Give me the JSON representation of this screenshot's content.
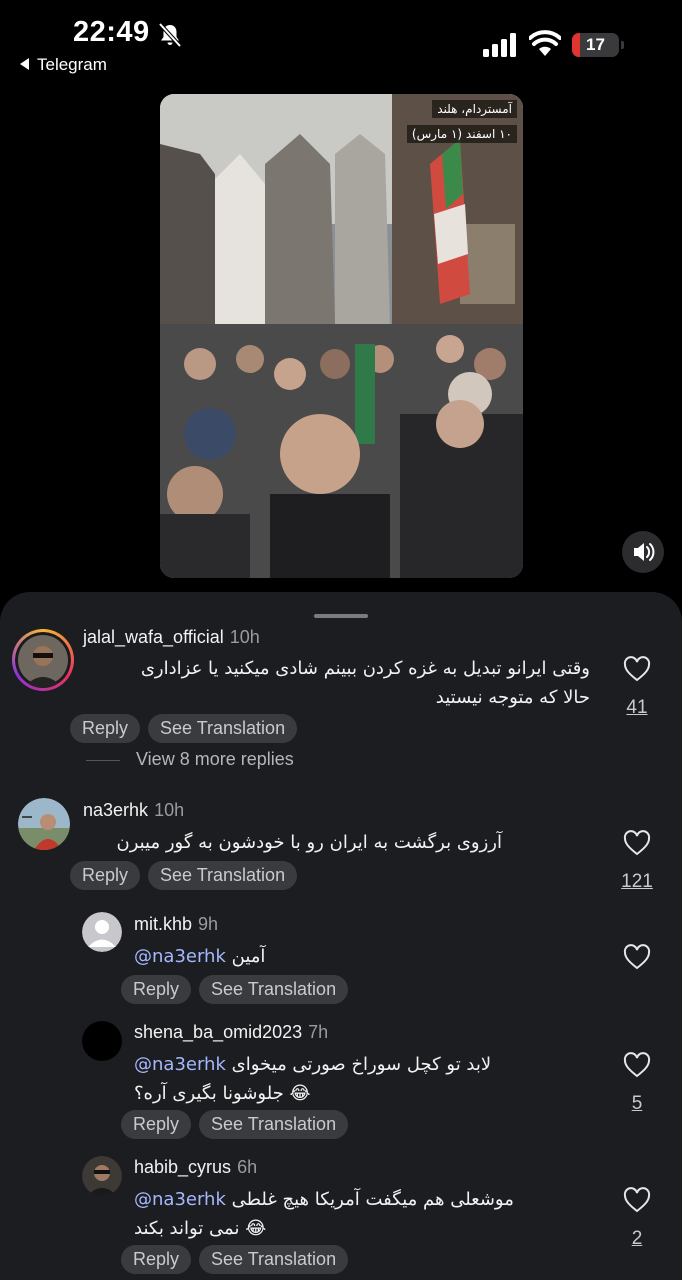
{
  "status_bar": {
    "time": "22:49",
    "back_app": "Telegram",
    "battery_level": "17",
    "battery_fraction": 0.17,
    "icons": [
      "bell-slash-icon",
      "cellular-signal-icon",
      "wifi-icon",
      "battery-icon"
    ]
  },
  "video": {
    "caption_location": "آمستردام، هلند",
    "caption_date": "۱۰ اسفند (۱ مارس)",
    "volume_icon": "speaker-icon"
  },
  "actions": {
    "reply": "Reply",
    "see_translation": "See Translation"
  },
  "comments": [
    {
      "username": "jalal_wafa_official",
      "time": "10h",
      "text_line1": "وقتی ایرانو تبدیل به غزه کردن ببینم شادی میکنید یا عزاداری",
      "text_line2": "حالا که متوجه نیستید",
      "likes": "41",
      "view_replies": "View 8 more replies"
    },
    {
      "username": "na3erhk",
      "time": "10h",
      "text_line1": "آرزوی برگشت به ایران رو با خودشون به گور میبرن",
      "likes": "121",
      "replies": [
        {
          "username": "mit.khb",
          "time": "9h",
          "mention": "@na3erhk",
          "text_line1": "آمین",
          "likes": ""
        },
        {
          "username": "shena_ba_omid2023",
          "time": "7h",
          "mention": "@na3erhk",
          "text_line1": "لابد تو کچل سوراخ صورتی میخوای",
          "text_line2": "جلوشونا بگیری آره؟ 😂",
          "likes": "5"
        },
        {
          "username": "habib_cyrus",
          "time": "6h",
          "mention": "@na3erhk",
          "text_line1": "موشعلی هم میگفت آمریکا هیچ غلطی",
          "text_line2": "نمی تواند بکند 😂",
          "likes": "2"
        }
      ]
    }
  ],
  "colors": {
    "background": "#000000",
    "sheet": "#1c1d21",
    "pill": "#3a3b3f",
    "mention": "#a5b8ff",
    "battery_low": "#e0342f"
  }
}
